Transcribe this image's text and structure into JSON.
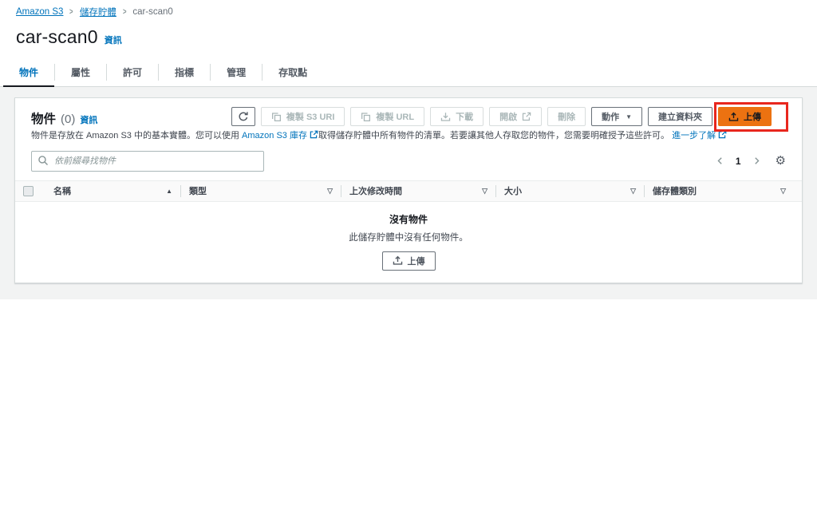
{
  "breadcrumb": {
    "items": [
      {
        "label": "Amazon S3"
      },
      {
        "label": "儲存貯體"
      },
      {
        "label": "car-scan0"
      }
    ]
  },
  "header": {
    "title": "car-scan0",
    "info_link": "資訊"
  },
  "tabs": [
    {
      "label": "物件",
      "active": true
    },
    {
      "label": "屬性"
    },
    {
      "label": "許可"
    },
    {
      "label": "指標"
    },
    {
      "label": "管理"
    },
    {
      "label": "存取點"
    }
  ],
  "panel": {
    "title": "物件",
    "count": "(0)",
    "info_link": "資訊",
    "description": {
      "part1": "物件是存放在 Amazon S3 中的基本實體。您可以使用 ",
      "link1": "Amazon S3 庫存",
      "part2": "取得儲存貯體中所有物件的清單。若要讓其他人存取您的物件，您需要明確授予這些許可。",
      "link2": "進一步了解"
    },
    "toolbar": {
      "copy_s3_uri": "複製 S3 URI",
      "copy_url": "複製 URL",
      "download": "下載",
      "open": "開啟",
      "delete": "刪除",
      "actions": "動作",
      "create_folder": "建立資料夾",
      "upload": "上傳"
    },
    "search_placeholder": "依前綴尋找物件",
    "pagination": {
      "current_page": "1"
    },
    "table": {
      "columns": [
        {
          "label": "名稱",
          "sort": "ascending"
        },
        {
          "label": "類型"
        },
        {
          "label": "上次修改時間"
        },
        {
          "label": "大小"
        },
        {
          "label": "儲存體類別"
        }
      ]
    },
    "empty_state": {
      "title": "沒有物件",
      "message": "此儲存貯體中沒有任何物件。",
      "upload_button": "上傳"
    }
  },
  "colors": {
    "primary_orange": "#ec7211",
    "link_blue": "#0073bb",
    "annotation_red": "#e8271e",
    "content_background": "#f2f3f3"
  },
  "icons": {
    "refresh": "circular-arrow ↻",
    "copy": "overlapping-squares ⧉",
    "download": "arrow-down-to-tray ⤓",
    "external_link": "arrow-out-of-box ↗",
    "upload": "arrow-up-from-tray ⇪",
    "search": "magnifier 🔍",
    "settings": "gear ⚙",
    "caret_down": "▼",
    "sort_ascending": "▲",
    "filter_caret": "▽",
    "chevron_left": "‹",
    "chevron_right": "›",
    "breadcrumb_separator": "›"
  }
}
